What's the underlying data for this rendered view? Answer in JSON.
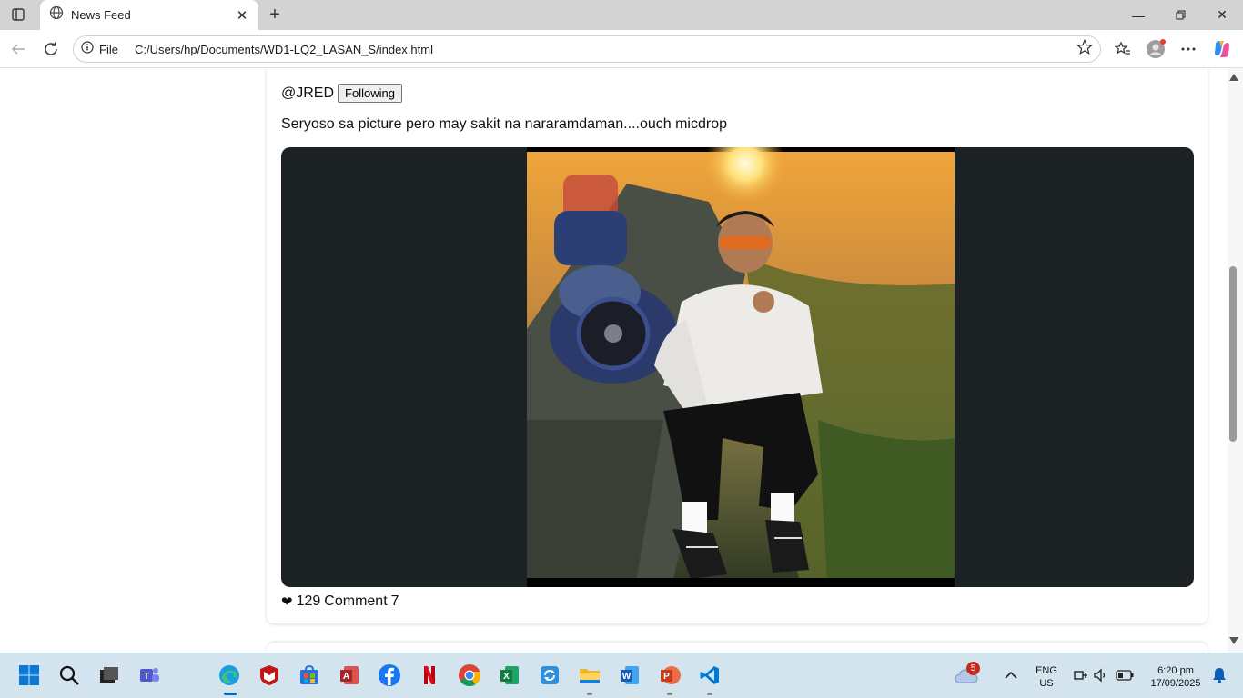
{
  "browser": {
    "tab_title": "News Feed",
    "address_label": "File",
    "url": "C:/Users/hp/Documents/WD1-LQ2_LASAN_S/index.html"
  },
  "post": {
    "username": "@JRED",
    "follow_label": "Following",
    "caption": "Seryoso sa picture pero may sakit na nararamdaman....ouch micdrop",
    "like_icon": "❤",
    "likes": "129",
    "comment_label": "Comment",
    "comments": "7"
  },
  "taskbar": {
    "weather_badge": "5",
    "lang_line1": "ENG",
    "lang_line2": "US",
    "time": "6:20 pm",
    "date": "17/09/2025"
  },
  "colors": {
    "accent": "#0067c0",
    "media_background": "#1c2123",
    "taskbar": "#d4e4ef"
  }
}
